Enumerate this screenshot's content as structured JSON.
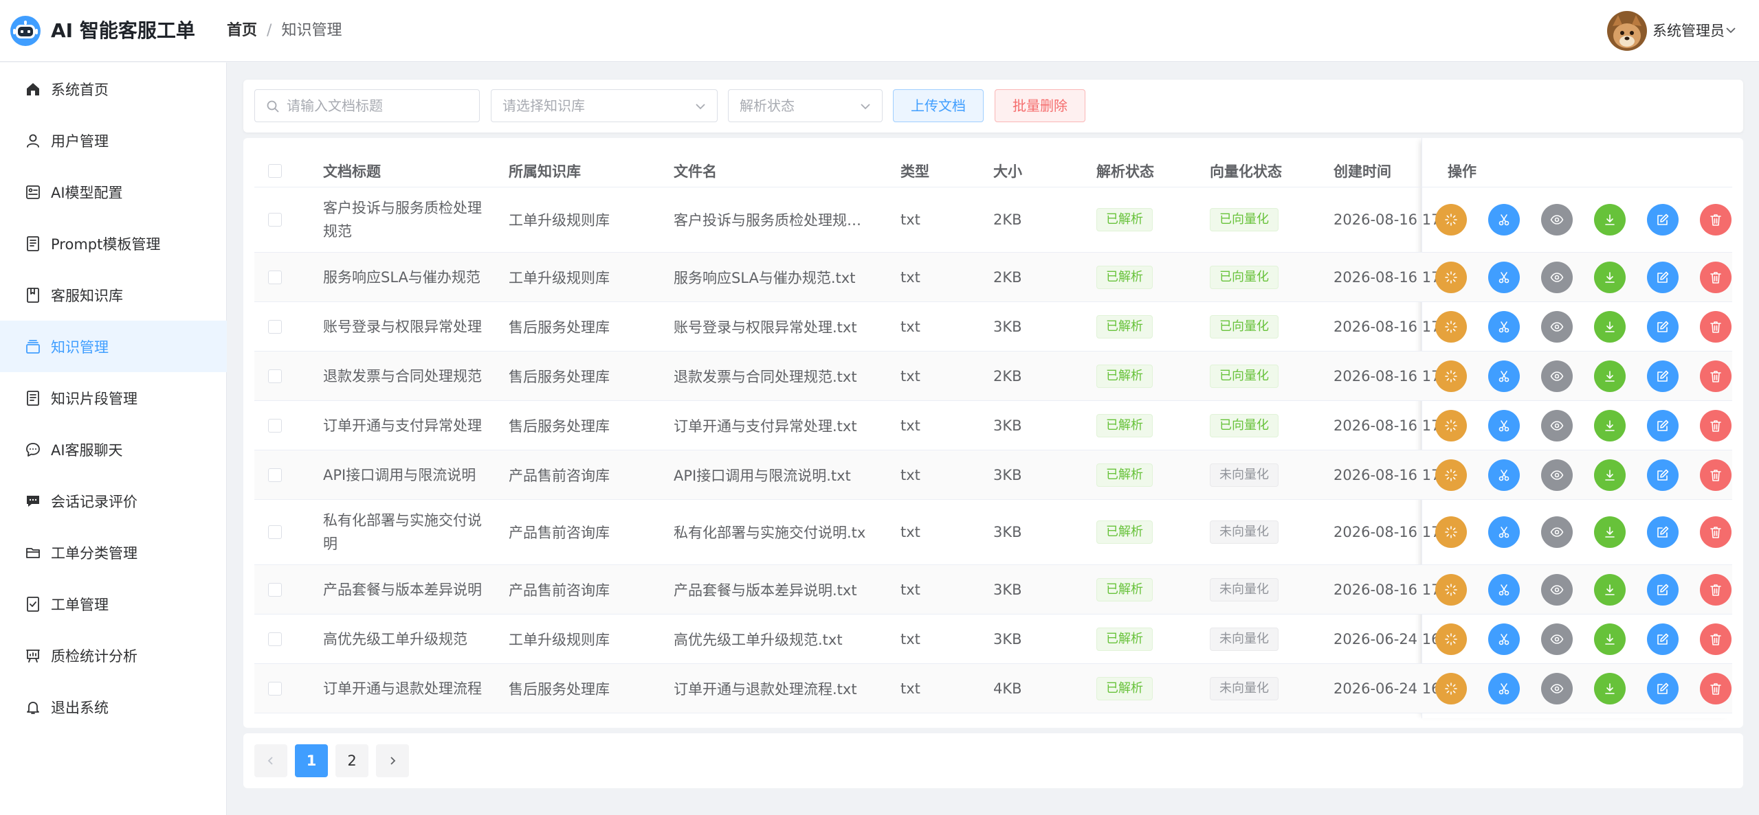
{
  "app": {
    "title": "AI 智能客服工单"
  },
  "breadcrumb": {
    "home": "首页",
    "sep": "/",
    "current": "知识管理"
  },
  "user": {
    "name": "系统管理员"
  },
  "sidebar": {
    "items": [
      {
        "label": "系统首页",
        "icon": "home-icon"
      },
      {
        "label": "用户管理",
        "icon": "user-icon"
      },
      {
        "label": "AI模型配置",
        "icon": "model-config-icon"
      },
      {
        "label": "Prompt模板管理",
        "icon": "document-icon"
      },
      {
        "label": "客服知识库",
        "icon": "book-icon"
      },
      {
        "label": "知识管理",
        "icon": "knowledge-icon",
        "active": true
      },
      {
        "label": "知识片段管理",
        "icon": "document-icon"
      },
      {
        "label": "AI客服聊天",
        "icon": "chat-icon"
      },
      {
        "label": "会话记录评价",
        "icon": "comment-icon"
      },
      {
        "label": "工单分类管理",
        "icon": "folder-icon"
      },
      {
        "label": "工单管理",
        "icon": "ticket-icon"
      },
      {
        "label": "质检统计分析",
        "icon": "chart-icon"
      },
      {
        "label": "退出系统",
        "icon": "bell-icon"
      }
    ]
  },
  "toolbar": {
    "search_placeholder": "请输入文档标题",
    "kb_select_placeholder": "请选择知识库",
    "status_select_placeholder": "解析状态",
    "upload_label": "上传文档",
    "batch_delete_label": "批量删除"
  },
  "table": {
    "columns": [
      "文档标题",
      "所属知识库",
      "文件名",
      "类型",
      "大小",
      "解析状态",
      "向量化状态",
      "创建时间",
      "操作"
    ],
    "rows": [
      {
        "title": "客户投诉与服务质检处理规范",
        "kb": "工单升级规则库",
        "file": "客户投诉与服务质检处理规…",
        "type": "txt",
        "size": "2KB",
        "parse": "已解析",
        "vector": "已向量化",
        "created": "2026-08-16 17"
      },
      {
        "title": "服务响应SLA与催办规范",
        "kb": "工单升级规则库",
        "file": "服务响应SLA与催办规范.txt",
        "type": "txt",
        "size": "2KB",
        "parse": "已解析",
        "vector": "已向量化",
        "created": "2026-08-16 17"
      },
      {
        "title": "账号登录与权限异常处理",
        "kb": "售后服务处理库",
        "file": "账号登录与权限异常处理.txt",
        "type": "txt",
        "size": "3KB",
        "parse": "已解析",
        "vector": "已向量化",
        "created": "2026-08-16 17"
      },
      {
        "title": "退款发票与合同处理规范",
        "kb": "售后服务处理库",
        "file": "退款发票与合同处理规范.txt",
        "type": "txt",
        "size": "2KB",
        "parse": "已解析",
        "vector": "已向量化",
        "created": "2026-08-16 17"
      },
      {
        "title": "订单开通与支付异常处理",
        "kb": "售后服务处理库",
        "file": "订单开通与支付异常处理.txt",
        "type": "txt",
        "size": "3KB",
        "parse": "已解析",
        "vector": "已向量化",
        "created": "2026-08-16 17"
      },
      {
        "title": "API接口调用与限流说明",
        "kb": "产品售前咨询库",
        "file": "API接口调用与限流说明.txt",
        "type": "txt",
        "size": "3KB",
        "parse": "已解析",
        "vector": "未向量化",
        "created": "2026-08-16 17"
      },
      {
        "title": "私有化部署与实施交付说明",
        "kb": "产品售前咨询库",
        "file": "私有化部署与实施交付说明.txt",
        "type": "txt",
        "size": "3KB",
        "parse": "已解析",
        "vector": "未向量化",
        "created": "2026-08-16 17"
      },
      {
        "title": "产品套餐与版本差异说明",
        "kb": "产品售前咨询库",
        "file": "产品套餐与版本差异说明.txt",
        "type": "txt",
        "size": "3KB",
        "parse": "已解析",
        "vector": "未向量化",
        "created": "2026-08-16 17"
      },
      {
        "title": "高优先级工单升级规范",
        "kb": "工单升级规则库",
        "file": "高优先级工单升级规范.txt",
        "type": "txt",
        "size": "3KB",
        "parse": "已解析",
        "vector": "未向量化",
        "created": "2026-06-24 16"
      },
      {
        "title": "订单开通与退款处理流程",
        "kb": "售后服务处理库",
        "file": "订单开通与退款处理流程.txt",
        "type": "txt",
        "size": "4KB",
        "parse": "已解析",
        "vector": "未向量化",
        "created": "2026-06-24 16"
      }
    ],
    "row_actions": [
      {
        "icon": "parse-icon",
        "color": "#e6a23c"
      },
      {
        "icon": "scissors-icon",
        "color": "#409eff"
      },
      {
        "icon": "eye-icon",
        "color": "#909399"
      },
      {
        "icon": "download-icon",
        "color": "#67c23a"
      },
      {
        "icon": "edit-icon",
        "color": "#409eff"
      },
      {
        "icon": "trash-icon",
        "color": "#f56c6c"
      }
    ]
  },
  "pagination": {
    "pages": [
      "1",
      "2"
    ],
    "current": "1"
  },
  "colors": {
    "primary": "#409eff",
    "success": "#67c23a",
    "warning": "#e6a23c",
    "danger": "#f56c6c",
    "info": "#909399"
  }
}
